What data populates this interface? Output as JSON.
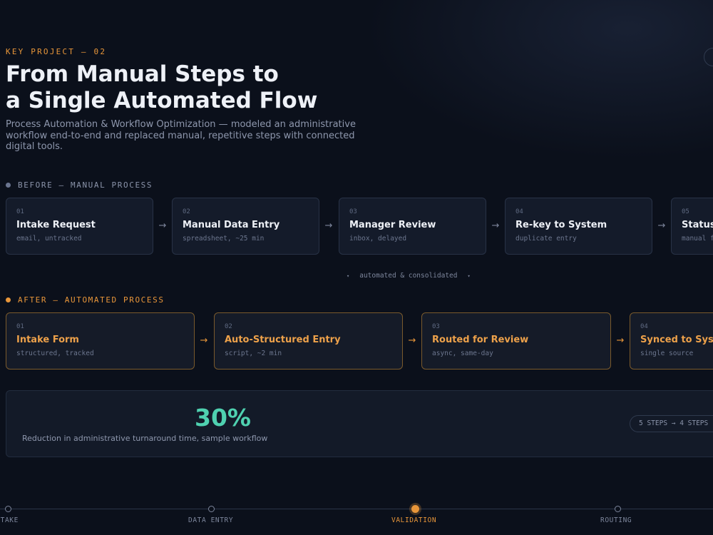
{
  "header": {
    "eyebrow": "KEY PROJECT — 02",
    "title_line1": "From Manual Steps to",
    "title_line2": "a Single Automated Flow",
    "subtitle": "Process Automation & Workflow Optimization — modeled an administrative workflow end-to-end and replaced manual, repetitive steps with connected digital tools."
  },
  "before": {
    "label": "BEFORE — MANUAL PROCESS",
    "steps": [
      {
        "num": "01",
        "name": "Intake Request",
        "note": "email, untracked"
      },
      {
        "num": "02",
        "name": "Manual Data Entry",
        "note": "spreadsheet, ~25 min"
      },
      {
        "num": "03",
        "name": "Manager Review",
        "note": "inbox, delayed"
      },
      {
        "num": "04",
        "name": "Re-key to System",
        "note": "duplicate entry"
      },
      {
        "num": "05",
        "name": "Status Update",
        "note": "manual follow-up"
      }
    ],
    "arrow": "→"
  },
  "transition": {
    "caret": "▾",
    "text": "automated & consolidated"
  },
  "after": {
    "label": "AFTER — AUTOMATED PROCESS",
    "steps": [
      {
        "num": "01",
        "name": "Intake Form",
        "note": "structured, tracked"
      },
      {
        "num": "02",
        "name": "Auto-Structured Entry",
        "note": "script, ~2 min"
      },
      {
        "num": "03",
        "name": "Routed for Review",
        "note": "async, same-day"
      },
      {
        "num": "04",
        "name": "Synced to System",
        "note": "single source"
      }
    ],
    "arrow": "→"
  },
  "metric": {
    "value": "30%",
    "caption": "Reduction in administrative turnaround time, sample workflow",
    "pill": "5 STEPS → 4 STEPS"
  },
  "timeline": {
    "stages": [
      {
        "label": "INTAKE",
        "active": false
      },
      {
        "label": "DATA ENTRY",
        "active": false
      },
      {
        "label": "VALIDATION",
        "active": true
      },
      {
        "label": "ROUTING",
        "active": false
      }
    ]
  },
  "colors": {
    "background": "#0b101b",
    "accent": "#e8963a",
    "metric": "#4fd1b0",
    "muted": "#8e97ad"
  }
}
